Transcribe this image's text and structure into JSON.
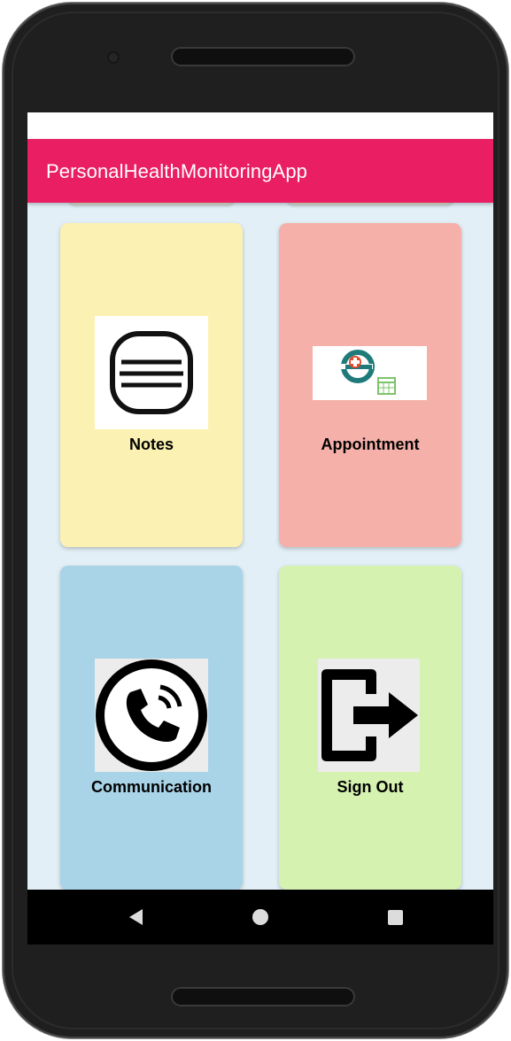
{
  "app": {
    "title": "PersonalHealthMonitoringApp",
    "accent_color": "#e91e63"
  },
  "cards": [
    {
      "label": "Notes",
      "icon": "notes-icon",
      "color": "#fbf1b2"
    },
    {
      "label": "Appointment",
      "icon": "appointment-icon",
      "color": "#f6b0aa"
    },
    {
      "label": "Communication",
      "icon": "phone-call-icon",
      "color": "#a9d3e7"
    },
    {
      "label": "Sign Out",
      "icon": "sign-out-icon",
      "color": "#d6f2b0"
    }
  ],
  "navigation": {
    "back": "back-triangle-icon",
    "home": "home-circle-icon",
    "recents": "recents-square-icon"
  }
}
